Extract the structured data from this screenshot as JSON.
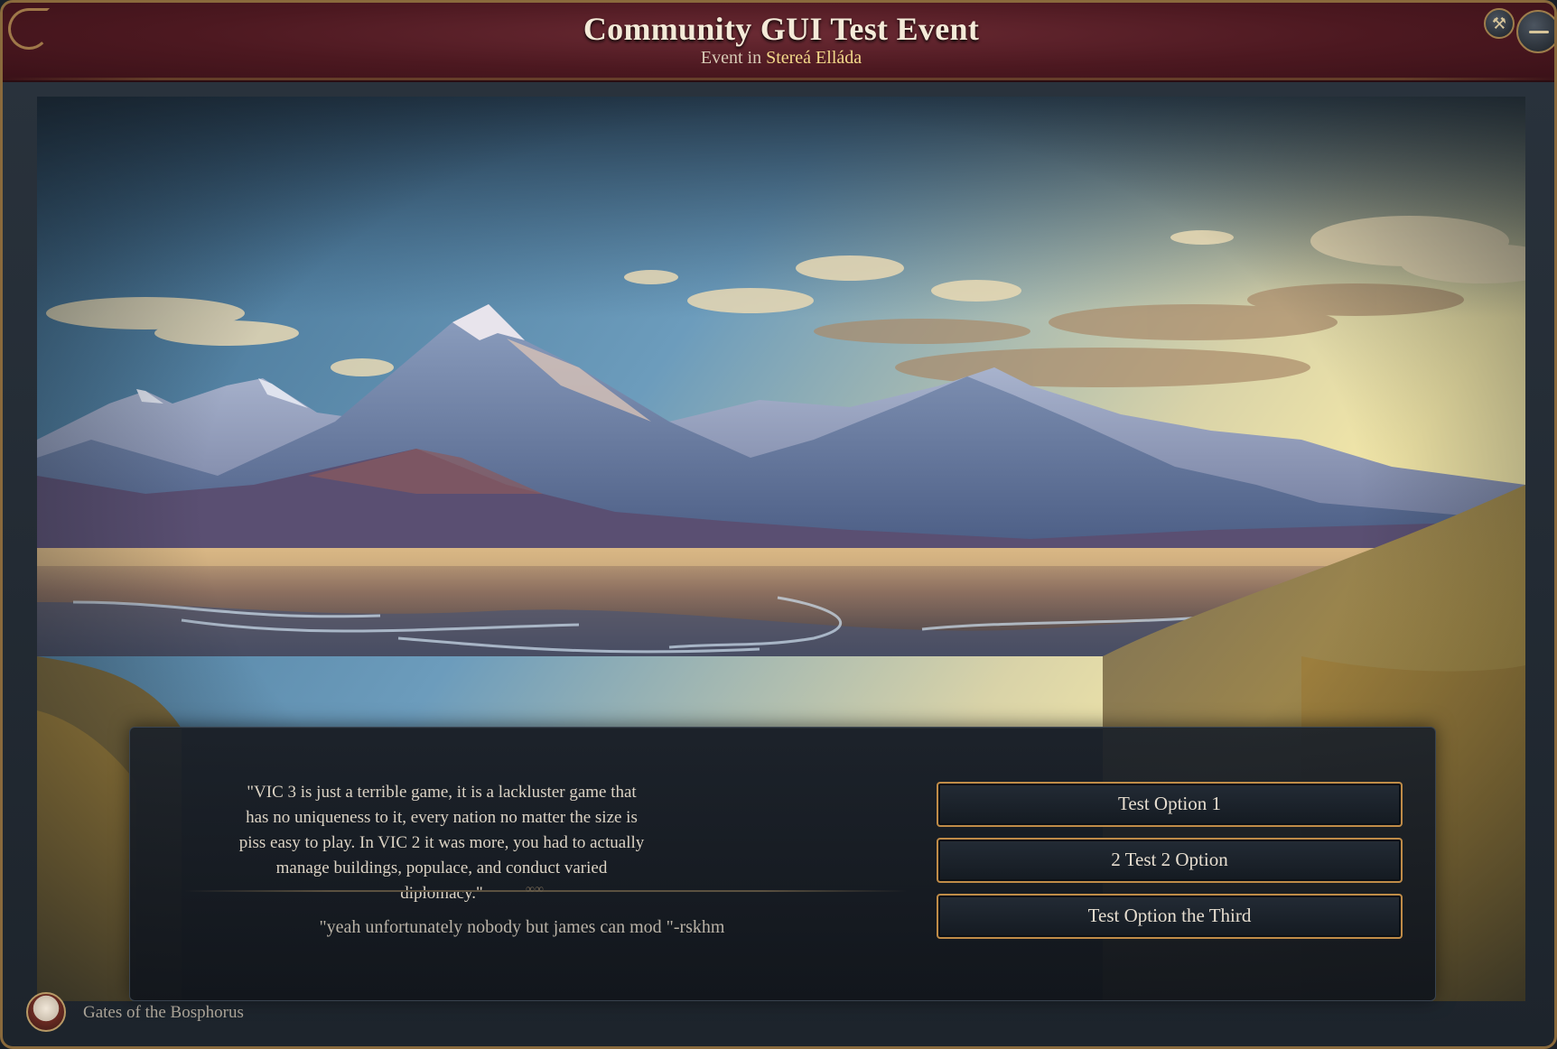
{
  "window": {
    "title": "Community GUI Test Event",
    "subtitle_prefix": "Event in ",
    "subtitle_location": "Stereá Elláda",
    "hammer_icon": "hammer-icon",
    "minimize_icon": "minimize-icon"
  },
  "event": {
    "description": "\"VIC 3 is just a terrible game, it is a lackluster game that has no uniqueness to it, every nation no matter the size is piss easy to play. In VIC 2 it was more, you had to actually manage buildings, populace, and conduct varied diplomacy.\"",
    "quote": "\"yeah unfortunately nobody but james can mod \"-rskhm"
  },
  "options": [
    {
      "label": "Test Option 1"
    },
    {
      "label": "2 Test 2 Option"
    },
    {
      "label": "Test Option the Third"
    }
  ],
  "footer": {
    "label": "Gates of the Bosphorus",
    "avatar_icon": "character-portrait-icon"
  },
  "colors": {
    "title_bar": "#4c1820",
    "frame_gold": "#c08c48",
    "location_highlight": "#f3d98a"
  }
}
